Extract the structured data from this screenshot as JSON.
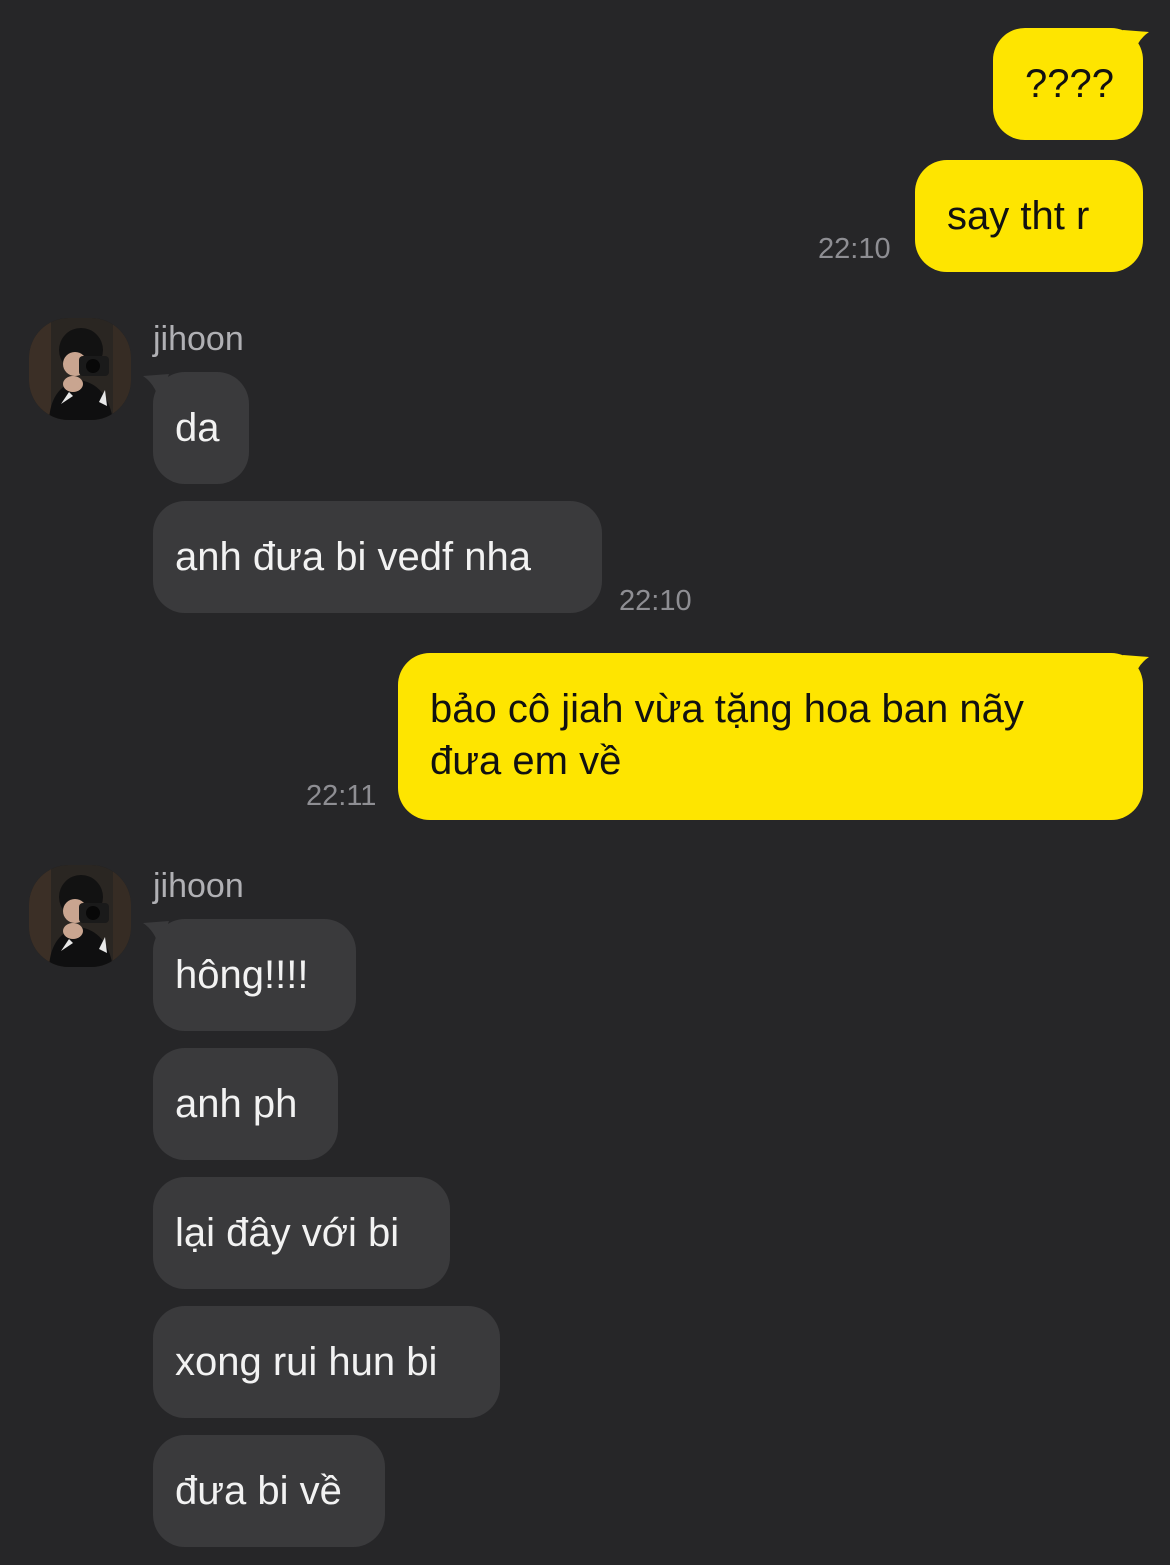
{
  "messages": {
    "m1": "????",
    "m2": "say tht r",
    "m2_time": "22:10",
    "m3": "da",
    "m4": "anh đưa bi vedf nha",
    "m4_time": "22:10",
    "m5_line1": "bảo cô jiah vừa tặng hoa ban nãy",
    "m5_line2": "đưa em về",
    "m5_time": "22:11",
    "m6": "hông!!!!",
    "m7": "anh ph",
    "m8": "lại đây với bi",
    "m9": "xong rui hun bi",
    "m10": "đưa bi về"
  },
  "contact": {
    "name": "jihoon",
    "avatar_icon": "profile-photo-camera"
  },
  "colors": {
    "background": "#262628",
    "outgoing_bubble": "#FEE500",
    "incoming_bubble": "#3a3a3c"
  }
}
